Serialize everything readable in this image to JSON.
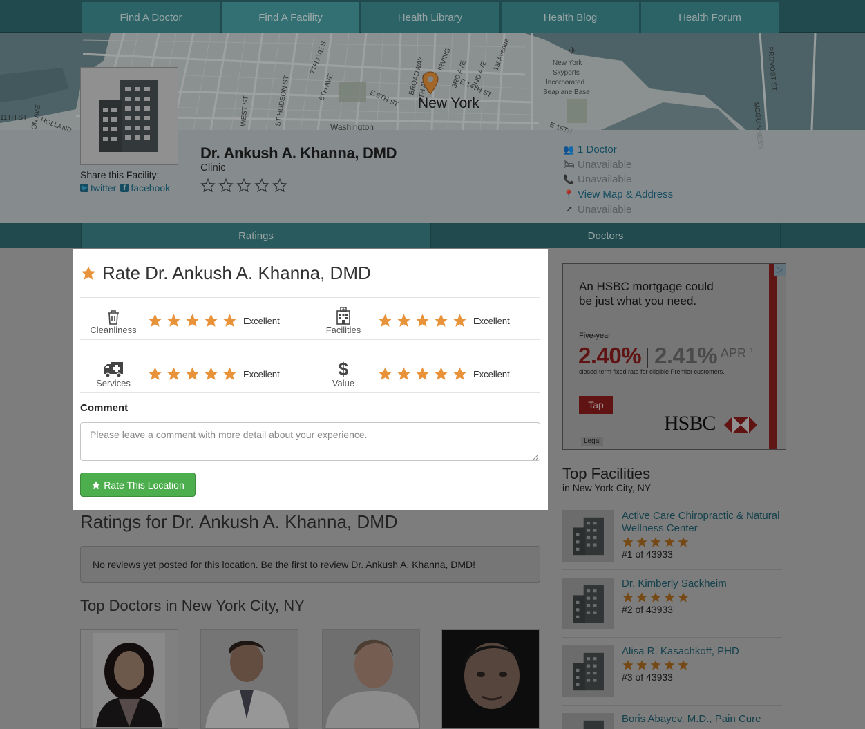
{
  "nav": {
    "tabs": [
      {
        "label": "Find A Doctor"
      },
      {
        "label": "Find A Facility"
      },
      {
        "label": "Health Library"
      },
      {
        "label": "Health Blog"
      },
      {
        "label": "Health Forum"
      }
    ],
    "active_index": 1
  },
  "map": {
    "city_label": "New York",
    "street_labels": [
      "11TH ST",
      "HOLLAND",
      "ON AVE",
      "ST HUDSON ST",
      "WEST ST",
      "7TH AVE S",
      "6TH AVE",
      "E 8TH ST",
      "BROADWAY",
      "4TH AVE",
      "IRVING",
      "3RD AVE",
      "2ND AVE",
      "E 14TH ST",
      "1st Avenue",
      "E 15TH",
      "PROVOST ST",
      "MCGUINNESS",
      "Washington"
    ],
    "poi_label": "New York Skyports Incorporated Seaplane Base"
  },
  "facility": {
    "name": "Dr. Ankush A. Khanna, DMD",
    "type": "Clinic",
    "rating": 0,
    "share_label": "Share this Facility:",
    "share_links": [
      "twitter",
      "facebook"
    ],
    "info": [
      {
        "icon": "users-icon",
        "text": "1 Doctor",
        "link": true
      },
      {
        "icon": "bed-icon",
        "text": "Unavailable",
        "link": false
      },
      {
        "icon": "phone-icon",
        "text": "Unavailable",
        "link": false
      },
      {
        "icon": "map-pin-icon",
        "text": "View Map & Address",
        "link": true
      },
      {
        "icon": "external-link-icon",
        "text": "Unavailable",
        "link": false
      }
    ]
  },
  "subtabs": [
    {
      "label": "Ratings"
    },
    {
      "label": "Doctors"
    }
  ],
  "rate_form": {
    "title": "Rate Dr. Ankush A. Khanna, DMD",
    "categories": [
      {
        "label": "Cleanliness",
        "icon": "trash-icon",
        "rating": 5,
        "rating_label": "Excellent"
      },
      {
        "label": "Facilities",
        "icon": "hospital-icon",
        "rating": 5,
        "rating_label": "Excellent"
      },
      {
        "label": "Services",
        "icon": "ambulance-icon",
        "rating": 5,
        "rating_label": "Excellent"
      },
      {
        "label": "Value",
        "icon": "dollar-icon",
        "rating": 5,
        "rating_label": "Excellent"
      }
    ],
    "comment_label": "Comment",
    "comment_placeholder": "Please leave a comment with more detail about your experience.",
    "comment_value": "",
    "submit_label": "Rate This Location"
  },
  "ratings_section": {
    "title": "Ratings for Dr. Ankush A. Khanna, DMD",
    "empty_message": "No reviews yet posted for this location. Be the first to review Dr. Ankush A. Khanna, DMD!"
  },
  "top_doctors": {
    "title": "Top Doctors in New York City, NY"
  },
  "ad": {
    "headline": "An HSBC mortgage could be just what you need.",
    "term": "Five-year",
    "rate": "2.40%",
    "apr_value": "2.41%",
    "apr_label": "APR",
    "apr_footnote": "1",
    "fine_print": "closed-term fixed rate for eligible Premier customers.",
    "cta": "Tap",
    "brand": "HSBC",
    "legal": "Legal",
    "colors": {
      "brand_red": "#db0011"
    }
  },
  "top_facilities": {
    "title": "Top Facilities",
    "subtitle": "in New York City, NY",
    "items": [
      {
        "name": "Active Care Chiropractic & Natural Wellness Center",
        "rating": 5,
        "rank": "#1 of 43933"
      },
      {
        "name": "Dr. Kimberly Sackheim",
        "rating": 5,
        "rank": "#2 of 43933"
      },
      {
        "name": "Alisa R. Kasachkoff, PHD",
        "rating": 5,
        "rank": "#3 of 43933"
      },
      {
        "name": "Boris Abayev, M.D., Pain Cure",
        "rating": null,
        "rank": ""
      }
    ]
  },
  "colors": {
    "teal": "#3f8f94",
    "star": "#e8923a",
    "link": "#1f6e8c",
    "button_green": "#5cb85c"
  }
}
